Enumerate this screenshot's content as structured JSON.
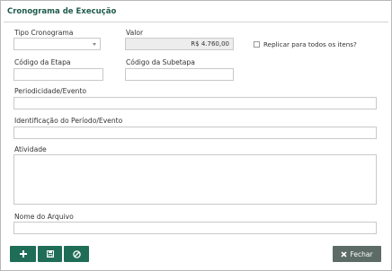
{
  "dialog": {
    "title": "Cronograma de Execução"
  },
  "form": {
    "tipo_cronograma": {
      "label": "Tipo Cronograma",
      "value": ""
    },
    "valor": {
      "label": "Valor",
      "value": "R$ 4.760,00"
    },
    "replicar": {
      "label": "Replicar para todos os itens?",
      "checked": false
    },
    "codigo_etapa": {
      "label": "Código da Etapa",
      "value": ""
    },
    "codigo_subetapa": {
      "label": "Código da Subetapa",
      "value": ""
    },
    "periodicidade": {
      "label": "Periodicidade/Evento",
      "value": ""
    },
    "identificacao": {
      "label": "Identificação do Período/Evento",
      "value": ""
    },
    "atividade": {
      "label": "Atividade",
      "value": ""
    },
    "nome_arquivo": {
      "label": "Nome do Arquivo",
      "value": ""
    }
  },
  "footer": {
    "close_label": "Fechar",
    "icons": [
      "plus-icon",
      "save-icon",
      "cancel-icon",
      "close-x-icon"
    ]
  },
  "colors": {
    "title": "#1f5a4c",
    "primary_button": "#1f6d56",
    "close_button": "#5c6b66",
    "field_border": "#c9c9c9",
    "readonly_field": "#ededed"
  }
}
